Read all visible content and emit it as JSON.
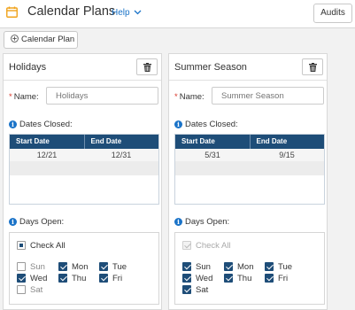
{
  "header": {
    "title": "Calendar Plans",
    "help_label": "Help",
    "audits_label": "Audits"
  },
  "toolbar": {
    "add_plan_label": "Calendar Plan"
  },
  "panels": [
    {
      "title": "Holidays",
      "name_label": "Name:",
      "name_placeholder": "Holidays",
      "dates_closed_label": "Dates Closed:",
      "columns": [
        "Start Date",
        "End Date"
      ],
      "rows": [
        [
          "12/21",
          "12/31"
        ]
      ],
      "days_open_label": "Days Open:",
      "check_all_label": "Check All",
      "check_all_state": "partial",
      "days": [
        {
          "label": "Sun",
          "checked": false
        },
        {
          "label": "Mon",
          "checked": true
        },
        {
          "label": "Tue",
          "checked": true
        },
        {
          "label": "Wed",
          "checked": true
        },
        {
          "label": "Thu",
          "checked": true
        },
        {
          "label": "Fri",
          "checked": true
        },
        {
          "label": "Sat",
          "checked": false
        }
      ]
    },
    {
      "title": "Summer Season",
      "name_label": "Name:",
      "name_placeholder": "Summer Season",
      "dates_closed_label": "Dates Closed:",
      "columns": [
        "Start Date",
        "End Date"
      ],
      "rows": [
        [
          "5/31",
          "9/15"
        ]
      ],
      "days_open_label": "Days Open:",
      "check_all_label": "Check All",
      "check_all_state": "checked-disabled",
      "days": [
        {
          "label": "Sun",
          "checked": true
        },
        {
          "label": "Mon",
          "checked": true
        },
        {
          "label": "Tue",
          "checked": true
        },
        {
          "label": "Wed",
          "checked": true
        },
        {
          "label": "Thu",
          "checked": true
        },
        {
          "label": "Fri",
          "checked": true
        },
        {
          "label": "Sat",
          "checked": true
        }
      ]
    }
  ],
  "colors": {
    "accent": "#1a73c8",
    "table_header": "#1e4d78",
    "checkbox": "#1e4d78",
    "required": "#d9372b"
  }
}
